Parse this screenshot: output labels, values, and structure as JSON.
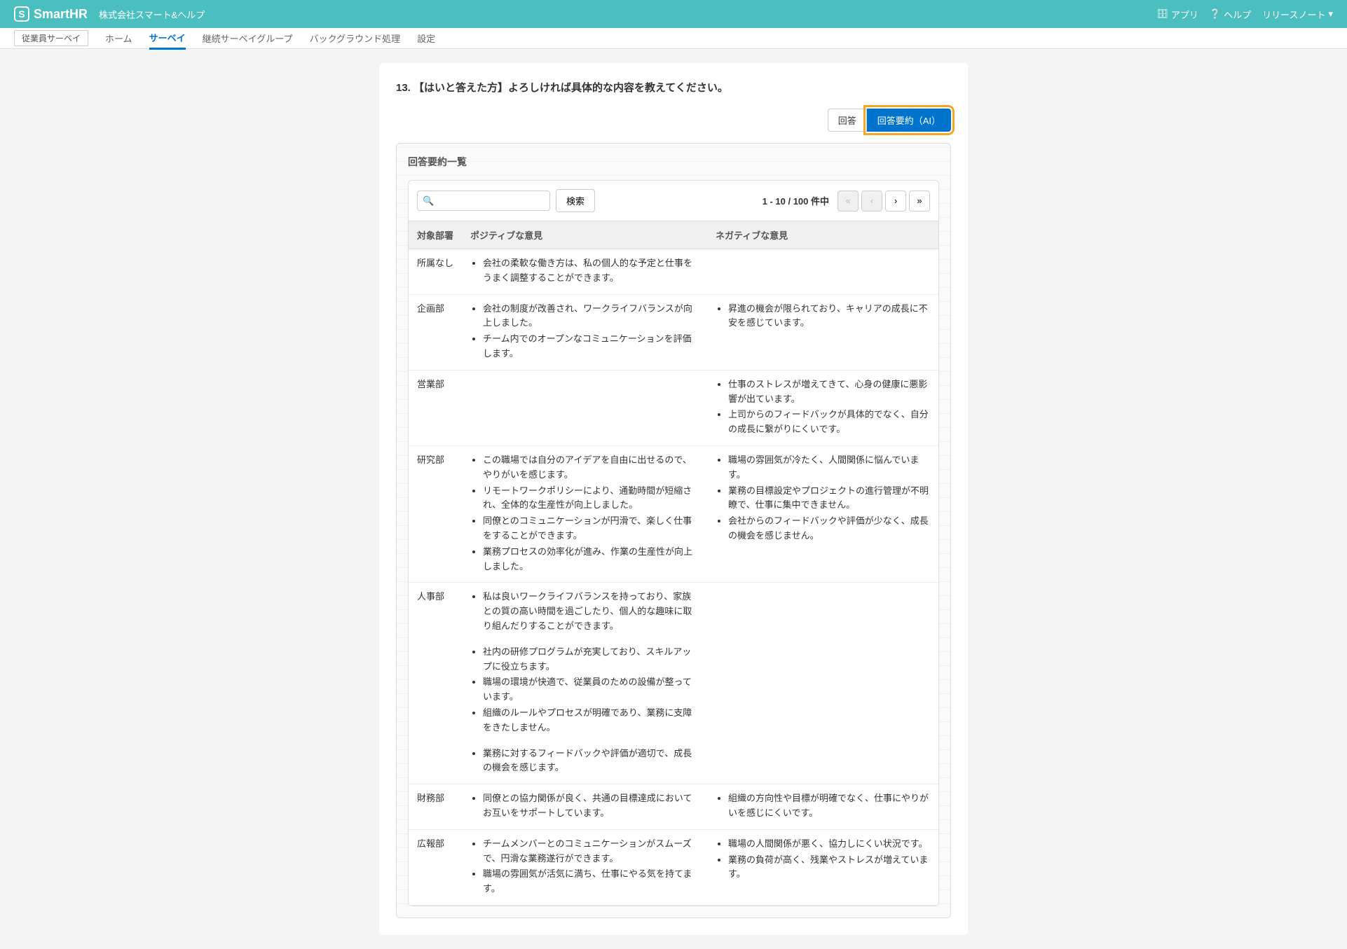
{
  "header": {
    "logo_text": "SmartHR",
    "logo_icon_char": "S",
    "company_name": "株式会社スマート&ヘルプ",
    "app_link": "アプリ",
    "help_link": "ヘルプ",
    "release_notes": "リリースノート"
  },
  "nav": {
    "badge": "従業員サーベイ",
    "items": [
      "ホーム",
      "サーベイ",
      "継続サーベイグループ",
      "バックグラウンド処理",
      "設定"
    ],
    "active_index": 1
  },
  "question": {
    "number": "13.",
    "text": "【はいと答えた方】よろしければ具体的な内容を教えてください。"
  },
  "tabs": {
    "answer": "回答",
    "summary_ai": "回答要約（AI）"
  },
  "summary": {
    "panel_title": "回答要約一覧",
    "search_button": "検索",
    "page_info": "1 - 10 / 100 件中",
    "columns": {
      "dept": "対象部署",
      "positive": "ポジティブな意見",
      "negative": "ネガティブな意見"
    },
    "rows": [
      {
        "dept": "所属なし",
        "positive": [
          "会社の柔軟な働き方は、私の個人的な予定と仕事をうまく調整することができます。"
        ],
        "negative": []
      },
      {
        "dept": "企画部",
        "positive": [
          "会社の制度が改善され、ワークライフバランスが向上しました。",
          "チーム内でのオープンなコミュニケーションを評価します。"
        ],
        "negative": [
          "昇進の機会が限られており、キャリアの成長に不安を感じています。"
        ]
      },
      {
        "dept": "営業部",
        "positive": [],
        "negative": [
          "仕事のストレスが増えてきて、心身の健康に悪影響が出ています。",
          "上司からのフィードバックが具体的でなく、自分の成長に繋がりにくいです。"
        ]
      },
      {
        "dept": "研究部",
        "positive": [
          "この職場では自分のアイデアを自由に出せるので、やりがいを感じます。",
          "リモートワークポリシーにより、通勤時間が短縮され、全体的な生産性が向上しました。",
          "同僚とのコミュニケーションが円滑で、楽しく仕事をすることができます。",
          "業務プロセスの効率化が進み、作業の生産性が向上しました。"
        ],
        "negative": [
          "職場の雰囲気が冷たく、人間関係に悩んでいます。",
          "業務の目標設定やプロジェクトの進行管理が不明瞭で、仕事に集中できません。",
          "会社からのフィードバックや評価が少なく、成長の機会を感じません。"
        ]
      },
      {
        "dept": "人事部",
        "positive_groups": [
          [
            "私は良いワークライフバランスを持っており、家族との質の高い時間を過ごしたり、個人的な趣味に取り組んだりすることができます。"
          ],
          [
            "社内の研修プログラムが充実しており、スキルアップに役立ちます。",
            "職場の環境が快適で、従業員のための設備が整っています。",
            "組織のルールやプロセスが明確であり、業務に支障をきたしません。"
          ],
          [
            "業務に対するフィードバックや評価が適切で、成長の機会を感じます。"
          ]
        ],
        "negative": []
      },
      {
        "dept": "財務部",
        "positive": [
          "同僚との協力関係が良く、共通の目標達成においてお互いをサポートしています。"
        ],
        "negative": [
          "組織の方向性や目標が明確でなく、仕事にやりがいを感じにくいです。"
        ]
      },
      {
        "dept": "広報部",
        "positive": [
          "チームメンバーとのコミュニケーションがスムーズで、円滑な業務遂行ができます。",
          "職場の雰囲気が活気に満ち、仕事にやる気を持てます。"
        ],
        "negative": [
          "職場の人間関係が悪く、協力しにくい状況です。",
          "業務の負荷が高く、残業やストレスが増えています。"
        ]
      }
    ]
  }
}
